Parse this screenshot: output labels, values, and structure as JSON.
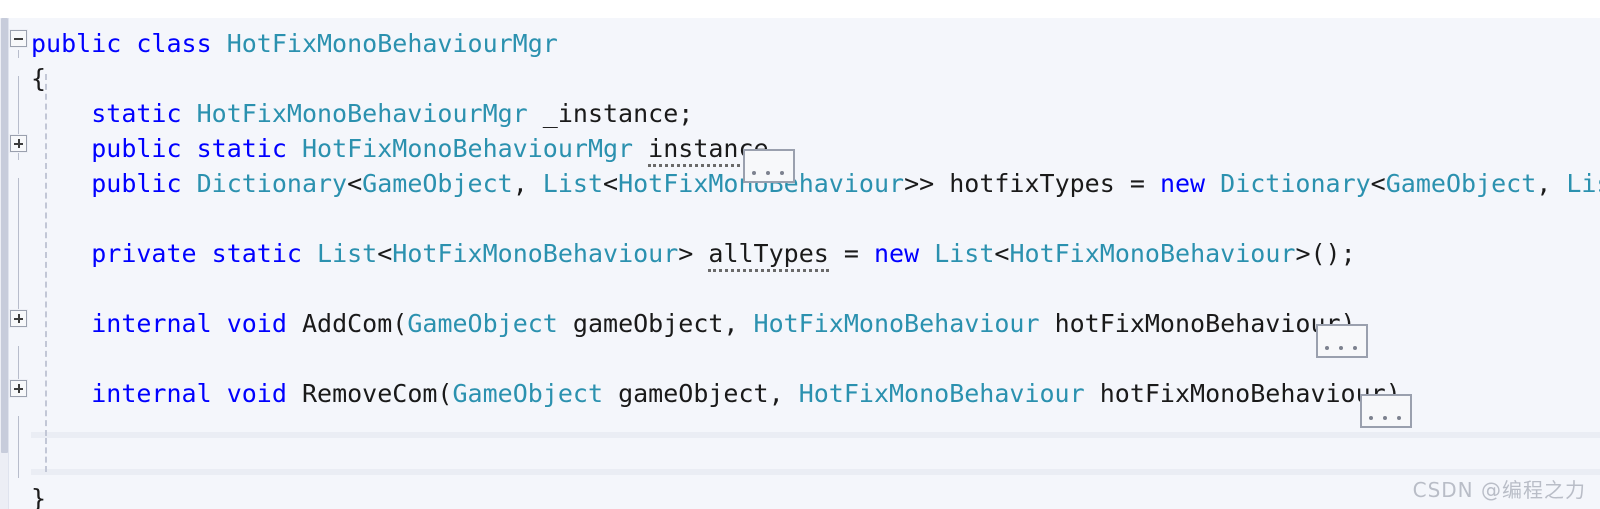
{
  "editor": {
    "background_color": "#f4f6fb",
    "keyword_color": "#0000ff",
    "type_color": "#2b91af",
    "identifier_color": "#1a1a1a",
    "language": "csharp"
  },
  "gutter": {
    "fold_markers": [
      {
        "state": "expanded",
        "glyph": "minus",
        "line": 1
      },
      {
        "state": "collapsed",
        "glyph": "plus",
        "line": 4
      },
      {
        "state": "collapsed",
        "glyph": "plus",
        "line": 9
      },
      {
        "state": "collapsed",
        "glyph": "plus",
        "line": 11
      }
    ]
  },
  "code": {
    "lines": [
      {
        "n": 1,
        "tokens": [
          {
            "t": "public",
            "c": "kw"
          },
          {
            "t": " ",
            "c": "id"
          },
          {
            "t": "class",
            "c": "kw"
          },
          {
            "t": " ",
            "c": "id"
          },
          {
            "t": "HotFixMonoBehaviourMgr",
            "c": "typ"
          }
        ]
      },
      {
        "n": 2,
        "tokens": [
          {
            "t": "{",
            "c": "brace"
          }
        ]
      },
      {
        "n": 3,
        "tokens": [
          {
            "t": "    ",
            "c": "id"
          },
          {
            "t": "static",
            "c": "kw"
          },
          {
            "t": " ",
            "c": "id"
          },
          {
            "t": "HotFixMonoBehaviourMgr",
            "c": "typ"
          },
          {
            "t": " _instance;",
            "c": "id"
          }
        ]
      },
      {
        "n": 4,
        "tokens": [
          {
            "t": "    ",
            "c": "id"
          },
          {
            "t": "public",
            "c": "kw"
          },
          {
            "t": " ",
            "c": "id"
          },
          {
            "t": "static",
            "c": "kw"
          },
          {
            "t": " ",
            "c": "id"
          },
          {
            "t": "HotFixMonoBehaviourMgr",
            "c": "typ"
          },
          {
            "t": " ",
            "c": "id"
          },
          {
            "t": "instance",
            "c": "id hintdot"
          }
        ]
      },
      {
        "n": 5,
        "tokens": [
          {
            "t": "    ",
            "c": "id"
          },
          {
            "t": "public",
            "c": "kw"
          },
          {
            "t": " ",
            "c": "id"
          },
          {
            "t": "Dictionary",
            "c": "typ"
          },
          {
            "t": "<",
            "c": "id"
          },
          {
            "t": "GameObject",
            "c": "typ"
          },
          {
            "t": ", ",
            "c": "id"
          },
          {
            "t": "List",
            "c": "typ"
          },
          {
            "t": "<",
            "c": "id"
          },
          {
            "t": "HotFixMonoBehaviour",
            "c": "typ"
          },
          {
            "t": ">> hotfixTypes = ",
            "c": "id"
          },
          {
            "t": "new",
            "c": "kw"
          },
          {
            "t": " ",
            "c": "id"
          },
          {
            "t": "Dictionary",
            "c": "typ"
          },
          {
            "t": "<",
            "c": "id"
          },
          {
            "t": "GameObject",
            "c": "typ"
          },
          {
            "t": ", ",
            "c": "id"
          },
          {
            "t": "Lis",
            "c": "typ"
          }
        ]
      },
      {
        "n": 6,
        "tokens": []
      },
      {
        "n": 7,
        "tokens": [
          {
            "t": "    ",
            "c": "id"
          },
          {
            "t": "private",
            "c": "kw"
          },
          {
            "t": " ",
            "c": "id"
          },
          {
            "t": "static",
            "c": "kw"
          },
          {
            "t": " ",
            "c": "id"
          },
          {
            "t": "List",
            "c": "typ"
          },
          {
            "t": "<",
            "c": "id"
          },
          {
            "t": "HotFixMonoBehaviour",
            "c": "typ"
          },
          {
            "t": "> ",
            "c": "id"
          },
          {
            "t": "allTypes",
            "c": "id hintdot"
          },
          {
            "t": " = ",
            "c": "id"
          },
          {
            "t": "new",
            "c": "kw"
          },
          {
            "t": " ",
            "c": "id"
          },
          {
            "t": "List",
            "c": "typ"
          },
          {
            "t": "<",
            "c": "id"
          },
          {
            "t": "HotFixMonoBehaviour",
            "c": "typ"
          },
          {
            "t": ">();",
            "c": "id"
          }
        ]
      },
      {
        "n": 8,
        "tokens": []
      },
      {
        "n": 9,
        "tokens": [
          {
            "t": "    ",
            "c": "id"
          },
          {
            "t": "internal",
            "c": "kw"
          },
          {
            "t": " ",
            "c": "id"
          },
          {
            "t": "void",
            "c": "kw"
          },
          {
            "t": " AddCom(",
            "c": "id"
          },
          {
            "t": "GameObject",
            "c": "typ"
          },
          {
            "t": " gameObject, ",
            "c": "id"
          },
          {
            "t": "HotFixMonoBehaviour",
            "c": "typ"
          },
          {
            "t": " hotFixMonoBehaviour)",
            "c": "id"
          }
        ]
      },
      {
        "n": 10,
        "tokens": []
      },
      {
        "n": 11,
        "tokens": [
          {
            "t": "    ",
            "c": "id"
          },
          {
            "t": "internal",
            "c": "kw"
          },
          {
            "t": " ",
            "c": "id"
          },
          {
            "t": "void",
            "c": "kw"
          },
          {
            "t": " RemoveCom(",
            "c": "id"
          },
          {
            "t": "GameObject",
            "c": "typ"
          },
          {
            "t": " gameObject, ",
            "c": "id"
          },
          {
            "t": "HotFixMonoBehaviour",
            "c": "typ"
          },
          {
            "t": " hotFixMonoBehaviour)",
            "c": "id"
          }
        ]
      },
      {
        "n": 12,
        "tokens": []
      },
      {
        "n": 13,
        "tokens": []
      },
      {
        "n": 14,
        "tokens": [
          {
            "t": "}",
            "c": "brace"
          }
        ]
      }
    ],
    "collapsed_regions": [
      {
        "label": "...",
        "after_line": 4
      },
      {
        "label": "...",
        "after_line": 9
      },
      {
        "label": "...",
        "after_line": 11
      }
    ]
  },
  "watermark": {
    "text": "CSDN @编程之力"
  }
}
